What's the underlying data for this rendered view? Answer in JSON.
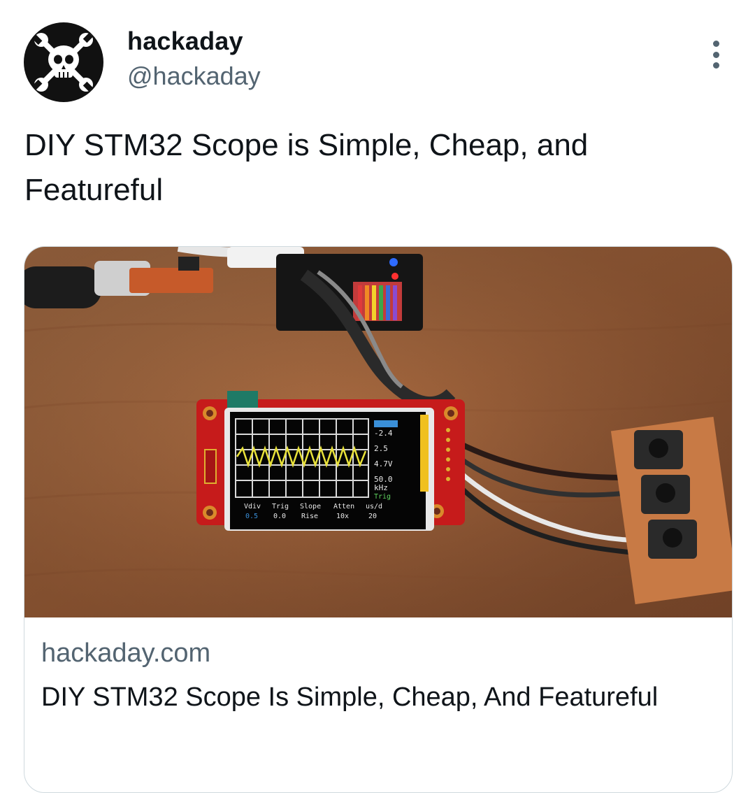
{
  "author": {
    "display_name": "hackaday",
    "handle": "@hackaday",
    "avatar_icon": "skull-wrenches-icon"
  },
  "more_icon": "more-options-icon",
  "tweet": {
    "text": "DIY STM32 Scope is Simple, Cheap, and Featureful"
  },
  "link_card": {
    "domain": "hackaday.com",
    "title": "DIY STM32 Scope Is Simple, Cheap, And Featureful",
    "screen": {
      "labels": [
        "Vdiv",
        "Trig",
        "Slope",
        "Atten",
        "us/d"
      ],
      "values": [
        "0.5",
        "0.0",
        "Rise",
        "10x",
        "20"
      ],
      "side": [
        "-2.4",
        "2.5",
        "4.7V",
        "50.0",
        "kHz",
        "Trig"
      ]
    }
  },
  "colors": {
    "text": "#0f1419",
    "secondary": "#536471",
    "border": "#cfd9de"
  }
}
